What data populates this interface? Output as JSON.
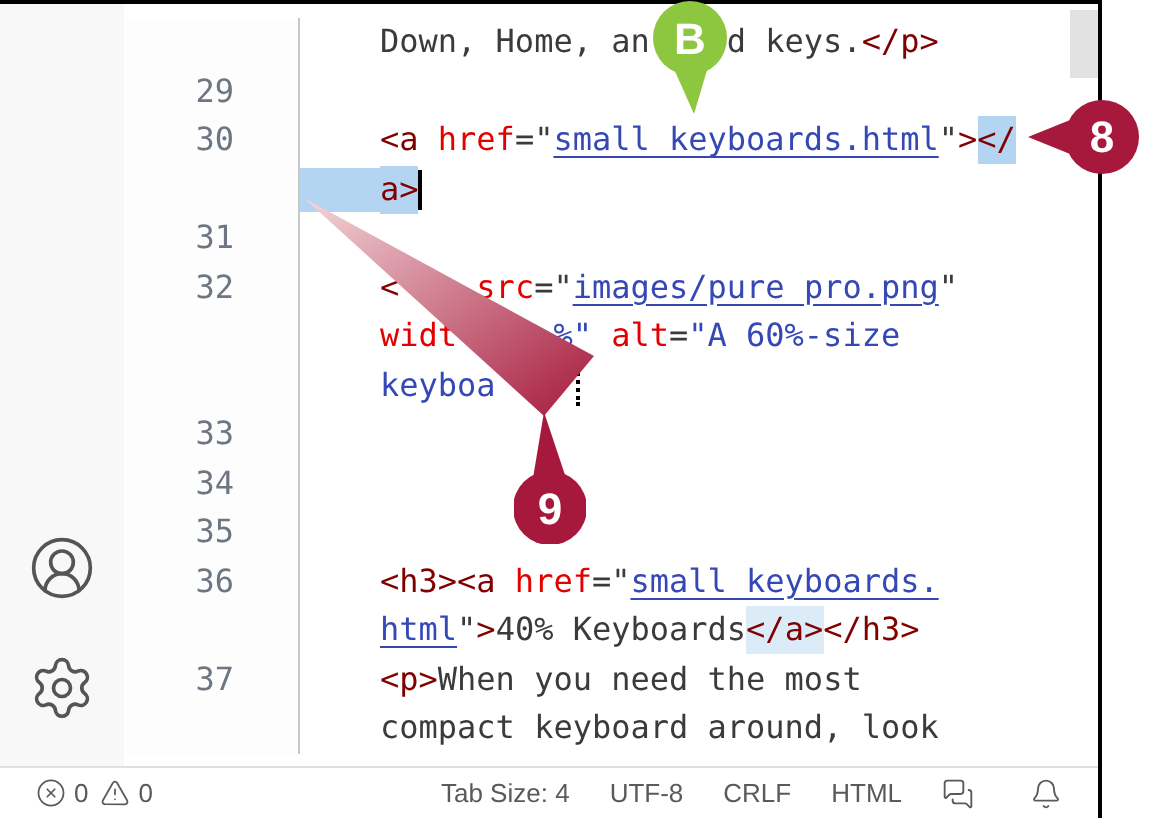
{
  "editor": {
    "rows": [
      {
        "tokens": [
          {
            "kind": "text",
            "text": "Down, Home, an"
          },
          {
            "kind": "gap-4"
          },
          {
            "kind": "text",
            "text": "d keys."
          },
          {
            "kind": "tag",
            "text": "</p>"
          }
        ]
      },
      {
        "number": "29"
      },
      {
        "number": "30",
        "tokens": [
          {
            "kind": "tag",
            "text": "<a"
          },
          {
            "kind": "attr",
            "text": " href"
          },
          {
            "kind": "punct",
            "text": "=\""
          },
          {
            "kind": "link",
            "text": "small_keyboards.html"
          },
          {
            "kind": "punct",
            "text": "\""
          },
          {
            "kind": "tag",
            "text": ">"
          },
          {
            "kind": "tag",
            "text": "</",
            "selected": true
          }
        ]
      },
      {
        "indent_selected": true,
        "tokens": [
          {
            "kind": "tag",
            "text": "a>",
            "selected": true
          },
          {
            "kind": "caret"
          }
        ]
      },
      {
        "number": "31"
      },
      {
        "number": "32",
        "tokens": [
          {
            "kind": "tag",
            "text": "<"
          },
          {
            "kind": "gap-4"
          },
          {
            "kind": "attr",
            "text": "src"
          },
          {
            "kind": "punct",
            "text": "=\""
          },
          {
            "kind": "link",
            "text": "images/pure_pro.png"
          },
          {
            "kind": "punct",
            "text": "\""
          }
        ]
      },
      {
        "tokens": [
          {
            "kind": "attr",
            "text": "widt"
          },
          {
            "kind": "gap-5"
          },
          {
            "kind": "string",
            "text": "%\""
          },
          {
            "kind": "attr",
            "text": " alt"
          },
          {
            "kind": "punct",
            "text": "="
          },
          {
            "kind": "string",
            "text": "\"A 60%-size"
          }
        ]
      },
      {
        "tokens": [
          {
            "kind": "string",
            "text": "keyboa"
          },
          {
            "kind": "gap-4"
          },
          {
            "kind": "drop-marker"
          }
        ]
      },
      {
        "number": "33"
      },
      {
        "number": "34"
      },
      {
        "number": "35"
      },
      {
        "number": "36",
        "tokens": [
          {
            "kind": "tag",
            "text": "<h3><a"
          },
          {
            "kind": "attr",
            "text": " href"
          },
          {
            "kind": "punct",
            "text": "=\""
          },
          {
            "kind": "link",
            "text": "small_keyboards."
          }
        ]
      },
      {
        "tokens": [
          {
            "kind": "link",
            "text": "html"
          },
          {
            "kind": "punct",
            "text": "\""
          },
          {
            "kind": "tag",
            "text": ">"
          },
          {
            "kind": "text",
            "text": "40% Keyboards"
          },
          {
            "kind": "tag",
            "text": "</a>",
            "matched": true
          },
          {
            "kind": "tag",
            "text": "</h3>"
          }
        ]
      },
      {
        "number": "37",
        "tokens": [
          {
            "kind": "tag",
            "text": "<p>"
          },
          {
            "kind": "text",
            "text": "When you need the most"
          }
        ]
      },
      {
        "tokens": [
          {
            "kind": "text",
            "text": "compact keyboard around, look"
          }
        ]
      }
    ]
  },
  "callouts": [
    {
      "label": "B",
      "color": "#8dc63f"
    },
    {
      "label": "8",
      "color": "#a6193c"
    },
    {
      "label": "9",
      "color": "#a6193c"
    }
  ],
  "status_bar": {
    "errors": "0",
    "warnings": "0",
    "items": [
      "Tab Size: 4",
      "UTF-8",
      "CRLF",
      "HTML"
    ]
  }
}
